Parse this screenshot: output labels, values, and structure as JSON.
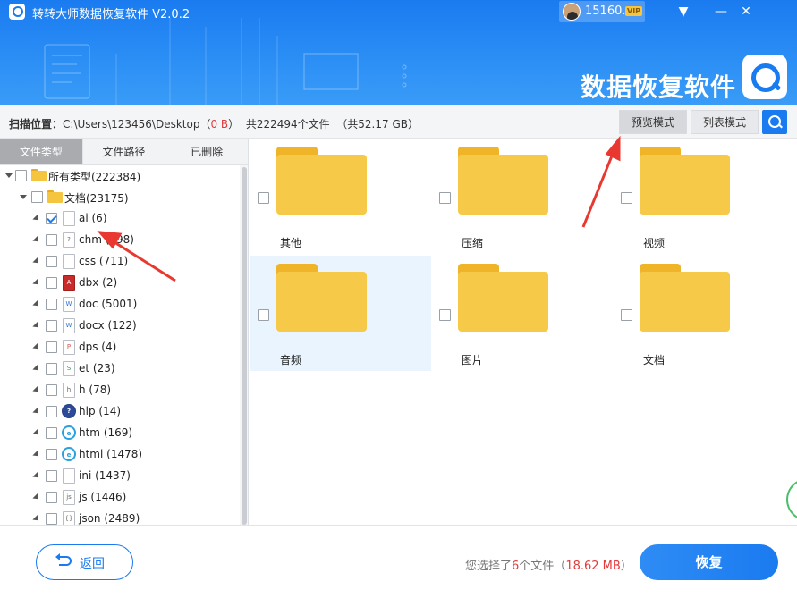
{
  "app": {
    "title": "转转大师数据恢复软件 V2.0.2",
    "user_name": "15160...",
    "vip_badge": "VIP",
    "brand_title": "数据恢复软件",
    "window_buttons": {
      "menu": "▼",
      "minimize": "—",
      "close": "✕"
    }
  },
  "infobar": {
    "scan_label": "扫描位置：",
    "scan_path": "C:\\Users\\123456\\Desktop",
    "path_size_open": "（",
    "path_size": "0 B",
    "path_size_close": "）",
    "total_files": "共222494个文件",
    "total_size": "（共52.17 GB）",
    "preview_mode": "预览模式",
    "list_mode": "列表模式"
  },
  "left_tabs": [
    "文件类型",
    "文件路径",
    "已删除"
  ],
  "tree": [
    {
      "label": "所有类型(222384)",
      "checked": false,
      "icon": "folder-icon"
    },
    {
      "label": "文档(23175)",
      "checked": false,
      "icon": "folder-icon"
    },
    {
      "label": "ai (6)",
      "checked": true,
      "icon": "ai-file-icon"
    },
    {
      "label": "chm (198)",
      "checked": false,
      "icon": "chm-file-icon"
    },
    {
      "label": "css (711)",
      "checked": false,
      "icon": "css-file-icon"
    },
    {
      "label": "dbx (2)",
      "checked": false,
      "icon": "dbx-file-icon"
    },
    {
      "label": "doc (5001)",
      "checked": false,
      "icon": "doc-file-icon"
    },
    {
      "label": "docx (122)",
      "checked": false,
      "icon": "docx-file-icon"
    },
    {
      "label": "dps (4)",
      "checked": false,
      "icon": "dps-file-icon"
    },
    {
      "label": "et (23)",
      "checked": false,
      "icon": "et-file-icon"
    },
    {
      "label": "h (78)",
      "checked": false,
      "icon": "h-file-icon"
    },
    {
      "label": "hlp (14)",
      "checked": false,
      "icon": "help-file-icon"
    },
    {
      "label": "htm (169)",
      "checked": false,
      "icon": "htm-file-icon"
    },
    {
      "label": "html (1478)",
      "checked": false,
      "icon": "html-file-icon"
    },
    {
      "label": "ini (1437)",
      "checked": false,
      "icon": "ini-file-icon"
    },
    {
      "label": "js (1446)",
      "checked": false,
      "icon": "js-file-icon"
    },
    {
      "label": "json (2489)",
      "checked": false,
      "icon": "json-file-icon"
    }
  ],
  "folders": [
    {
      "label": "其他",
      "selected": false
    },
    {
      "label": "压缩",
      "selected": false
    },
    {
      "label": "视频",
      "selected": false
    },
    {
      "label": "音频",
      "selected": true
    },
    {
      "label": "图片",
      "selected": false
    },
    {
      "label": "文档",
      "selected": false
    }
  ],
  "footer": {
    "back_label": "返回",
    "summary_prefix": "您选择了",
    "selected_count": "6",
    "summary_mid": "个文件（",
    "selected_size": "18.62 MB",
    "summary_suffix": "）",
    "recover_label": "恢复"
  },
  "colors": {
    "accent": "#1a7bf0",
    "highlight_red": "#e23b3b",
    "folder_yellow": "#f7c948",
    "selected_bg": "#e9f4fe"
  }
}
